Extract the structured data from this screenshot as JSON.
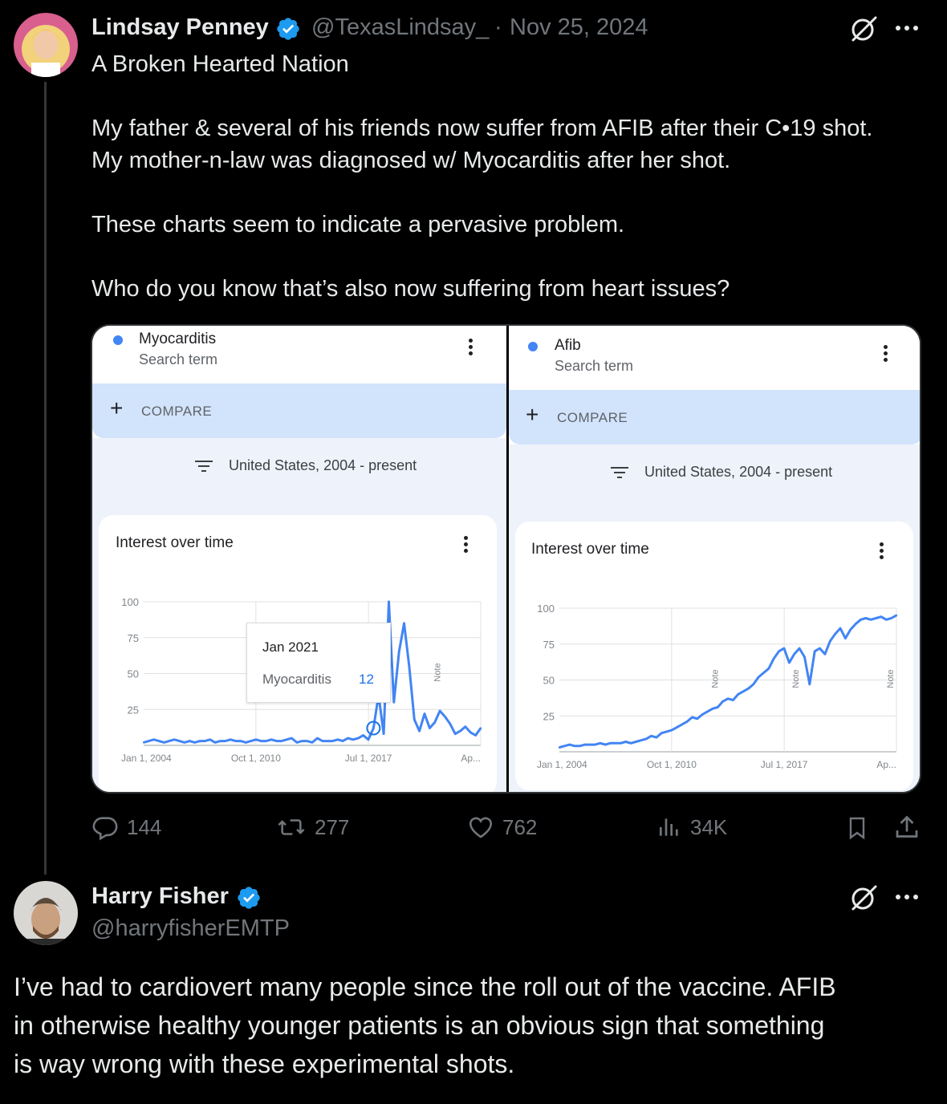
{
  "colors": {
    "background": "#000000",
    "text_primary": "#e7e9ea",
    "text_secondary": "#71767b",
    "verified_blue": "#1d9bf0",
    "trends_line": "#4285f4",
    "compare_bar": "#d2e3fc"
  },
  "tweet1": {
    "author_name": "Lindsay Penney",
    "handle": "@TexasLindsay_",
    "separator": "·",
    "date": "Nov 25, 2024",
    "lines": [
      "A Broken Hearted Nation",
      "",
      "My father & several of his friends now suffer from AFIB after their C•19 shot.",
      "My mother-n-law was diagnosed w/ Myocarditis after her shot.",
      "",
      "These charts seem to indicate a pervasive problem.",
      "",
      "Who do you know that’s also now suffering from heart issues?"
    ],
    "actions": {
      "replies": "144",
      "reposts": "277",
      "likes": "762",
      "views": "34K"
    },
    "icons": [
      "verified-badge-icon",
      "grok-icon",
      "more-icon",
      "reply-icon",
      "repost-icon",
      "like-icon",
      "views-icon",
      "bookmark-icon",
      "share-icon"
    ]
  },
  "trends_left": {
    "term": "Myocarditis",
    "term_sub": "Search term",
    "compare_label": "COMPARE",
    "region": "United States, 2004 - present",
    "card_title": "Interest over time",
    "tooltip": {
      "date": "Jan 2021",
      "term": "Myocarditis",
      "value": "12"
    }
  },
  "trends_right": {
    "term": "Afib",
    "term_sub": "Search term",
    "compare_label": "COMPARE",
    "region": "United States, 2004 - present",
    "card_title": "Interest over time"
  },
  "chart_data": [
    {
      "type": "line",
      "title": "Interest over time",
      "series": [
        {
          "name": "Myocarditis",
          "values": [
            2,
            3,
            4,
            3,
            2,
            3,
            4,
            3,
            2,
            3,
            2,
            3,
            3,
            4,
            2,
            3,
            3,
            4,
            3,
            3,
            2,
            3,
            4,
            3,
            3,
            4,
            3,
            3,
            4,
            5,
            2,
            3,
            3,
            2,
            5,
            3,
            3,
            3,
            4,
            3,
            5,
            4,
            5,
            7,
            4,
            12,
            35,
            8,
            100,
            30,
            65,
            85,
            55,
            18,
            10,
            22,
            12,
            16,
            24,
            20,
            15,
            8,
            10,
            13,
            9,
            7,
            12
          ]
        }
      ],
      "x_tick_labels": [
        "Jan 1, 2004",
        "Oct 1, 2010",
        "Jul 1, 2017",
        "Ap..."
      ],
      "y_ticks": [
        0,
        25,
        50,
        75,
        100
      ],
      "ylim": [
        0,
        100
      ],
      "annotations": [
        "Note"
      ],
      "grid": true
    },
    {
      "type": "line",
      "title": "Interest over time",
      "series": [
        {
          "name": "Afib",
          "values": [
            3,
            4,
            5,
            4,
            4,
            5,
            5,
            5,
            6,
            5,
            6,
            6,
            6,
            7,
            6,
            7,
            8,
            9,
            11,
            10,
            13,
            14,
            15,
            17,
            19,
            21,
            24,
            23,
            26,
            28,
            30,
            31,
            35,
            37,
            36,
            40,
            42,
            44,
            47,
            52,
            55,
            58,
            65,
            70,
            72,
            62,
            68,
            72,
            66,
            47,
            70,
            72,
            68,
            77,
            82,
            86,
            79,
            85,
            89,
            92,
            93,
            92,
            93,
            94,
            92,
            93,
            95
          ]
        }
      ],
      "x_tick_labels": [
        "Jan 1, 2004",
        "Oct 1, 2010",
        "Jul 1, 2017",
        "Ap..."
      ],
      "y_ticks": [
        0,
        25,
        50,
        75,
        100
      ],
      "ylim": [
        0,
        100
      ],
      "annotations": [
        "Note",
        "Note",
        "Note"
      ],
      "grid": true
    }
  ],
  "tweet2": {
    "author_name": "Harry Fisher",
    "handle": "@harryfisherEMTP",
    "lines": [
      "I’ve had to cardiovert many people since the roll out of the vaccine. AFIB",
      "in otherwise healthy younger patients is an obvious sign that something",
      "is way wrong with these experimental shots."
    ]
  }
}
